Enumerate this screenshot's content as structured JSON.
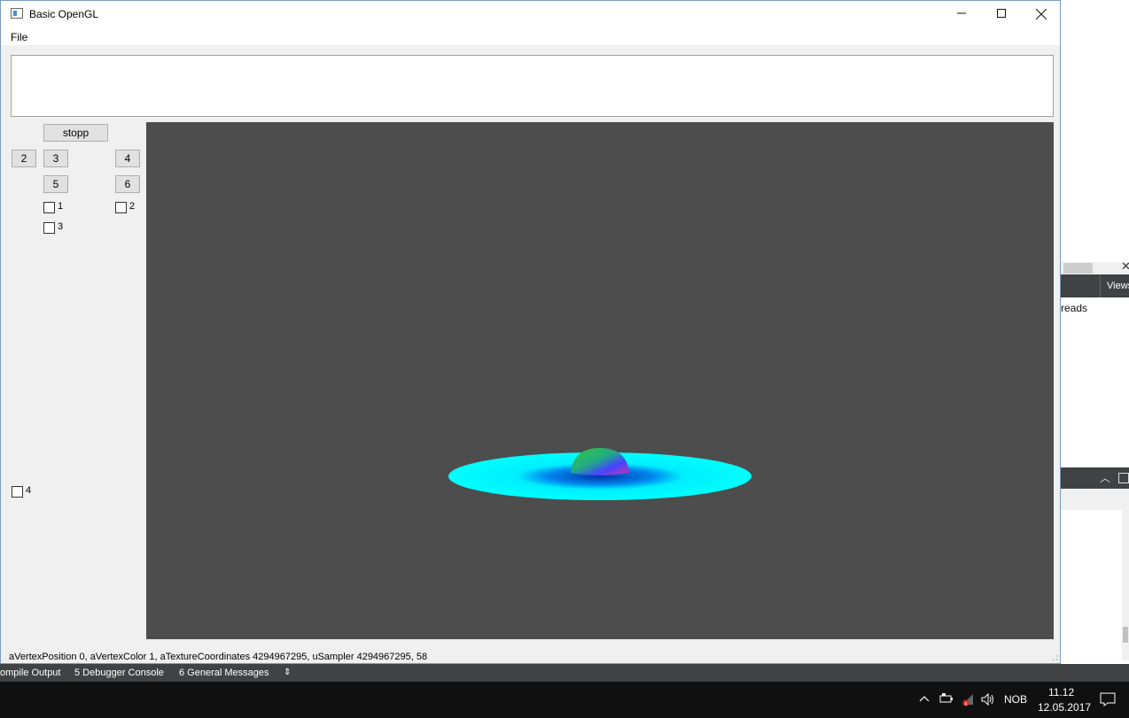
{
  "window": {
    "title": "Basic OpenGL",
    "menu": [
      "File"
    ],
    "buttons": {
      "stopp": "stopp",
      "b2": "2",
      "b3": "3",
      "b4": "4",
      "b5": "5",
      "b6": "6"
    },
    "checkboxes": [
      {
        "label": "1",
        "checked": false
      },
      {
        "label": "2",
        "checked": false
      },
      {
        "label": "3",
        "checked": false
      },
      {
        "label": "4",
        "checked": false
      }
    ],
    "text_area_value": "",
    "status": "aVertexPosition 0, aVertexColor 1, aTextureCoordinates 4294967295, uSampler 4294967295, 58",
    "gl_background": "#4d4d4d",
    "disc_color": "#00ffff"
  },
  "ide_background": {
    "views_label": "Views",
    "threads_label": "reads",
    "bottom_tabs": [
      "ompile Output",
      "5  Debugger Console",
      "6  General Messages"
    ]
  },
  "taskbar": {
    "language": "NOB",
    "time": "11.12",
    "date": "12.05.2017"
  }
}
